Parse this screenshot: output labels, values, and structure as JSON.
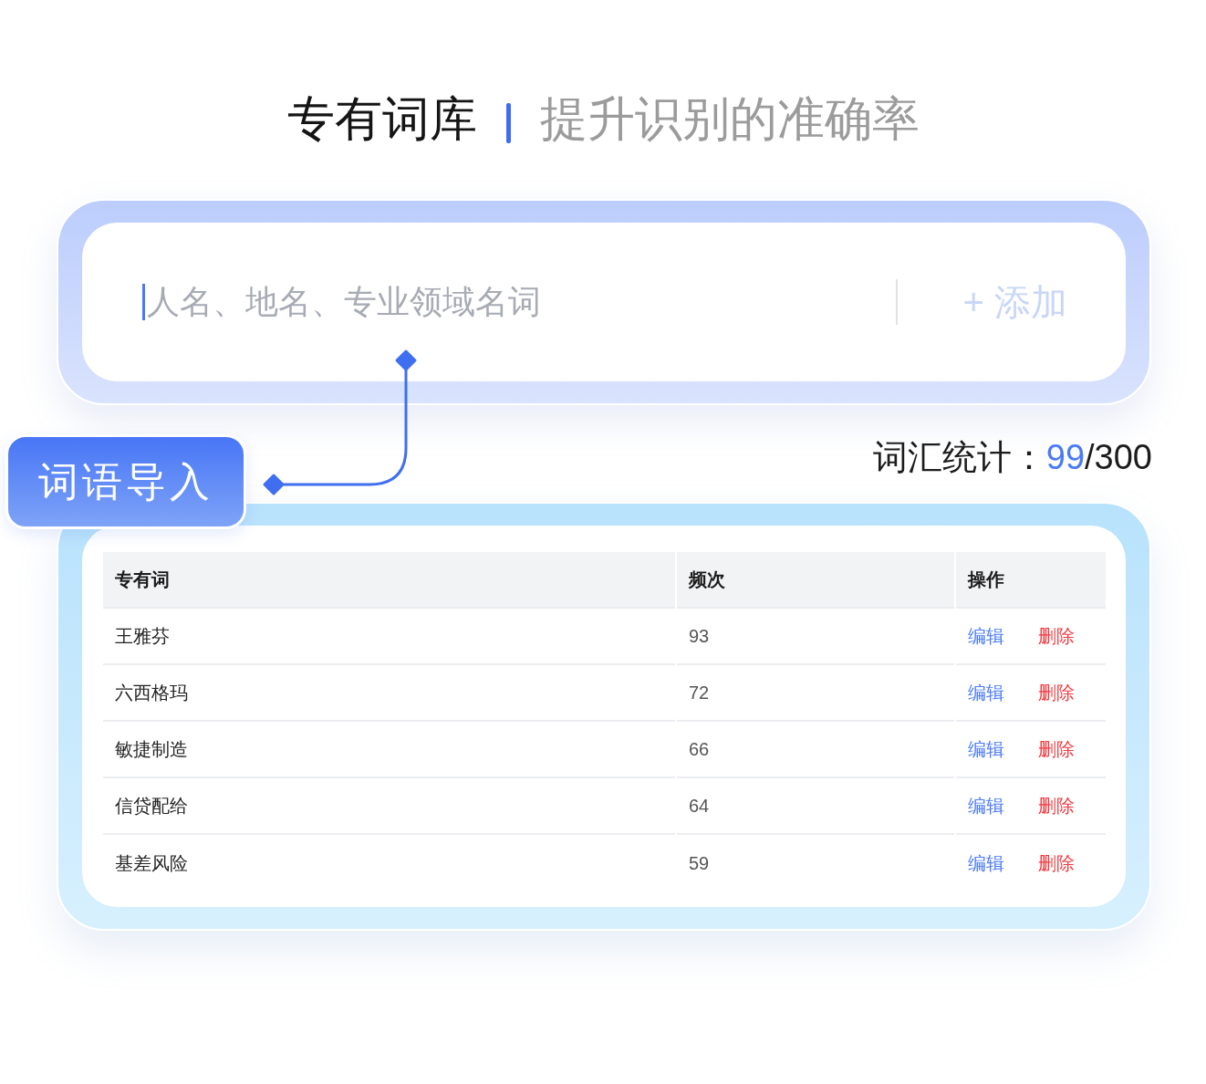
{
  "header": {
    "title": "专有词库",
    "subtitle": "提升识别的准确率"
  },
  "input": {
    "placeholder": "人名、地名、专业领域名词",
    "focused": true,
    "add_button": "+ 添加"
  },
  "import_button": "词语导入",
  "stats": {
    "label": "词汇统计：",
    "used": "99",
    "limit": "/300"
  },
  "table": {
    "columns": [
      "专有词",
      "频次",
      "操作"
    ],
    "rows": [
      {
        "term": "王雅芬",
        "frequency": "93",
        "actions": [
          {
            "kind": "edit",
            "label": "编辑"
          },
          {
            "kind": "delete",
            "label": "删除"
          }
        ]
      },
      {
        "term": "六西格玛",
        "frequency": "72",
        "actions": [
          {
            "kind": "edit",
            "label": "编辑"
          },
          {
            "kind": "delete",
            "label": "删除"
          }
        ]
      },
      {
        "term": "敏捷制造",
        "frequency": "66",
        "actions": [
          {
            "kind": "edit",
            "label": "编辑"
          },
          {
            "kind": "delete",
            "label": "删除"
          }
        ]
      },
      {
        "term": "信贷配给",
        "frequency": "64",
        "actions": [
          {
            "kind": "edit",
            "label": "编辑"
          },
          {
            "kind": "delete",
            "label": "删除"
          }
        ]
      },
      {
        "term": "基差风险",
        "frequency": "59",
        "actions": [
          {
            "kind": "edit",
            "label": "编辑"
          },
          {
            "kind": "delete",
            "label": "删除"
          }
        ]
      }
    ]
  }
}
